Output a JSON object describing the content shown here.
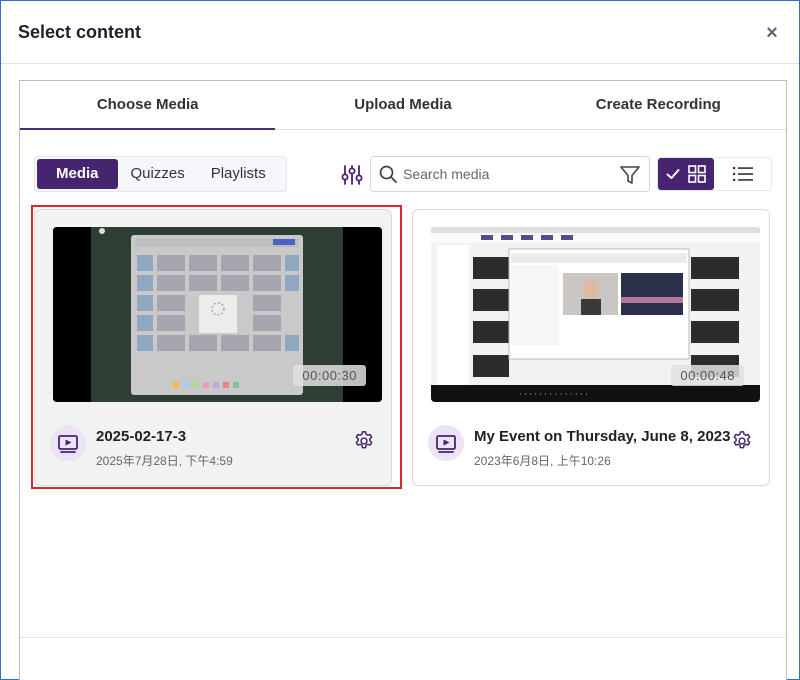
{
  "dialog": {
    "title": "Select content",
    "close_label": "×"
  },
  "tabs": [
    {
      "label": "Choose Media",
      "active": true
    },
    {
      "label": "Upload Media",
      "active": false
    },
    {
      "label": "Create Recording",
      "active": false
    }
  ],
  "filters": {
    "segments": [
      {
        "label": "Media",
        "active": true
      },
      {
        "label": "Quizzes",
        "active": false
      },
      {
        "label": "Playlists",
        "active": false
      }
    ]
  },
  "search": {
    "placeholder": "Search media",
    "value": ""
  },
  "view": {
    "mode": "grid"
  },
  "cards": [
    {
      "title": "2025-02-17-3",
      "date": "2025年7月28日, 下午4:59",
      "duration": "00:00:30",
      "selected": true,
      "icon": "video-icon"
    },
    {
      "title": "My Event on Thursday, June 8, 2023",
      "date": "2023年6月8日, 上午10:26",
      "duration": "00:00:48",
      "selected": false,
      "icon": "video-icon"
    }
  ],
  "colors": {
    "accent": "#46246f",
    "selection": "#e0252b",
    "icon_bg": "#ece4f5"
  }
}
